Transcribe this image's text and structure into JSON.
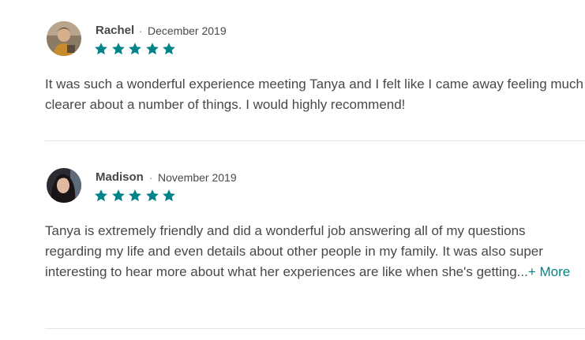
{
  "reviews": [
    {
      "name": "Rachel",
      "separator": "·",
      "date": "December 2019",
      "rating": 5,
      "text": "It was such a wonderful experience meeting Tanya and I felt like I came away feeling much clearer about a number of things. I would highly recommend!",
      "more_label": ""
    },
    {
      "name": "Madison",
      "separator": "·",
      "date": "November 2019",
      "rating": 5,
      "text": "Tanya is extremely friendly and did a wonderful job answering all of my questions regarding my life and even details about other people in my family. It was also super interesting to hear more about what her experiences are like when she's getting...",
      "more_label": "+ More"
    }
  ],
  "colors": {
    "star": "#008489",
    "link": "#008489",
    "text": "#484848",
    "divider": "#e4e4e4"
  },
  "icons": {
    "star": "star-icon"
  }
}
